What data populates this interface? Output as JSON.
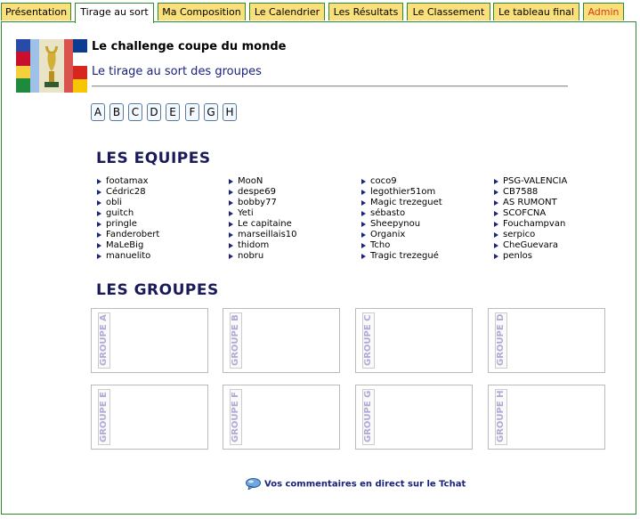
{
  "tabs": [
    {
      "label": "Présentation",
      "active": false
    },
    {
      "label": "Tirage au sort",
      "active": true
    },
    {
      "label": "Ma Composition",
      "active": false
    },
    {
      "label": "Le Calendrier",
      "active": false
    },
    {
      "label": "Les Résultats",
      "active": false
    },
    {
      "label": "Le Classement",
      "active": false
    },
    {
      "label": "Le tableau final",
      "active": false
    },
    {
      "label": "Admin",
      "active": false
    }
  ],
  "header": {
    "title": "Le challenge coupe du monde",
    "subtitle": "Le tirage au sort des groupes"
  },
  "group_letters": [
    "A",
    "B",
    "C",
    "D",
    "E",
    "F",
    "G",
    "H"
  ],
  "teams_heading": "LES EQUIPES",
  "teams": [
    [
      "footamax",
      "Cédric28",
      "obli",
      "guitch",
      "pringle",
      "Fanderobert",
      "MaLeBig",
      "manuelito"
    ],
    [
      "MooN",
      "despe69",
      "bobby77",
      "Yeti",
      "Le capitaine",
      "marseillais10",
      "thidom",
      "nobru"
    ],
    [
      "coco9",
      "legothier51om",
      "Magic trezeguet",
      "sébasto",
      "Sheepynou",
      "Organix",
      "Tcho",
      "Tragic trezegué"
    ],
    [
      "PSG-VALENCIA",
      "CB7588",
      "AS RUMONT",
      "SCOFCNA",
      "Fouchampvan",
      "serpico",
      "CheGuevara",
      "penlos"
    ]
  ],
  "groups_heading": "LES GROUPES",
  "groups": [
    "GROUPE A",
    "GROUPE B",
    "GROUPE C",
    "GROUPE D",
    "GROUPE E",
    "GROUPE F",
    "GROUPE G",
    "GROUPE H"
  ],
  "footer": {
    "chat_link": "Vos commentaires en direct sur le Tchat"
  },
  "colors": {
    "tab_bg": "#f9e07a",
    "border_green": "#2e8b2e",
    "admin_red": "#d83a12",
    "heading_navy": "#1a1a5a",
    "group_label": "#b3a8d6"
  }
}
